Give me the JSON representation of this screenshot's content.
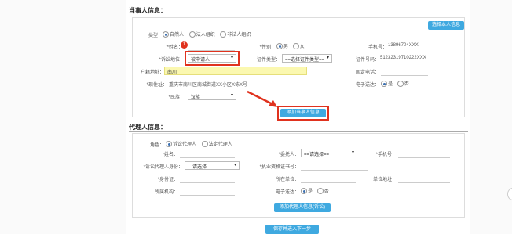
{
  "party": {
    "title": "当事人信息：",
    "select_self_btn": "选择本人信息",
    "type_label": "类型：",
    "type_options": [
      "自然人",
      "法人组织",
      "非法人组织"
    ],
    "name_label": "*姓名：",
    "gender_label": "*性别：",
    "gender_options": [
      "男",
      "女"
    ],
    "phone_label": "手机号：",
    "phone_value": "13896704XXX",
    "status_label": "*诉讼地位：",
    "status_value": "被申请人",
    "cert_type_label": "证件类型：",
    "cert_type_value": "==选择证件类型==",
    "cert_no_label": "证件号码：",
    "cert_no_value": "51232319710222XXX",
    "hukou_label": "户籍地址：",
    "hukou_value": "南川",
    "fixed_phone_label": "固定电话：",
    "address_label": "*现住址：",
    "address_value": "重庆市南川区南城街道XX小区X栋X号",
    "eservice_label": "电子送达：",
    "eservice_options": [
      "是",
      "否"
    ],
    "ethnic_label": "*民族：",
    "ethnic_value": "汉族",
    "add_btn": "添加当事人信息",
    "badge": "1"
  },
  "agent": {
    "title": "代理人信息：",
    "role_label": "角色：",
    "role_options": [
      "诉讼代理人",
      "法定代理人"
    ],
    "name_label": "*姓名：",
    "principal_label": "*委托人：",
    "principal_value": "==请选择==",
    "phone_label": "*手机号：",
    "identity_label": "*诉讼代理人身份：",
    "identity_value": "---请选择---",
    "license_label": "*执业资格证书号：",
    "id_label": "*身份证：",
    "unit_label": "所在单位：",
    "unit_addr_label": "单位地址：",
    "org_label": "所属机构：",
    "eservice_label": "电子送达：",
    "eservice_options": [
      "是",
      "否"
    ],
    "add_btn": "添加代理人信息(诉讼)"
  },
  "footer": {
    "save_btn": "保存并进入下一步"
  },
  "colors": {
    "accent": "#3fa9e0",
    "highlight": "#e0321e",
    "field_highlight": "#fbf8b0"
  }
}
